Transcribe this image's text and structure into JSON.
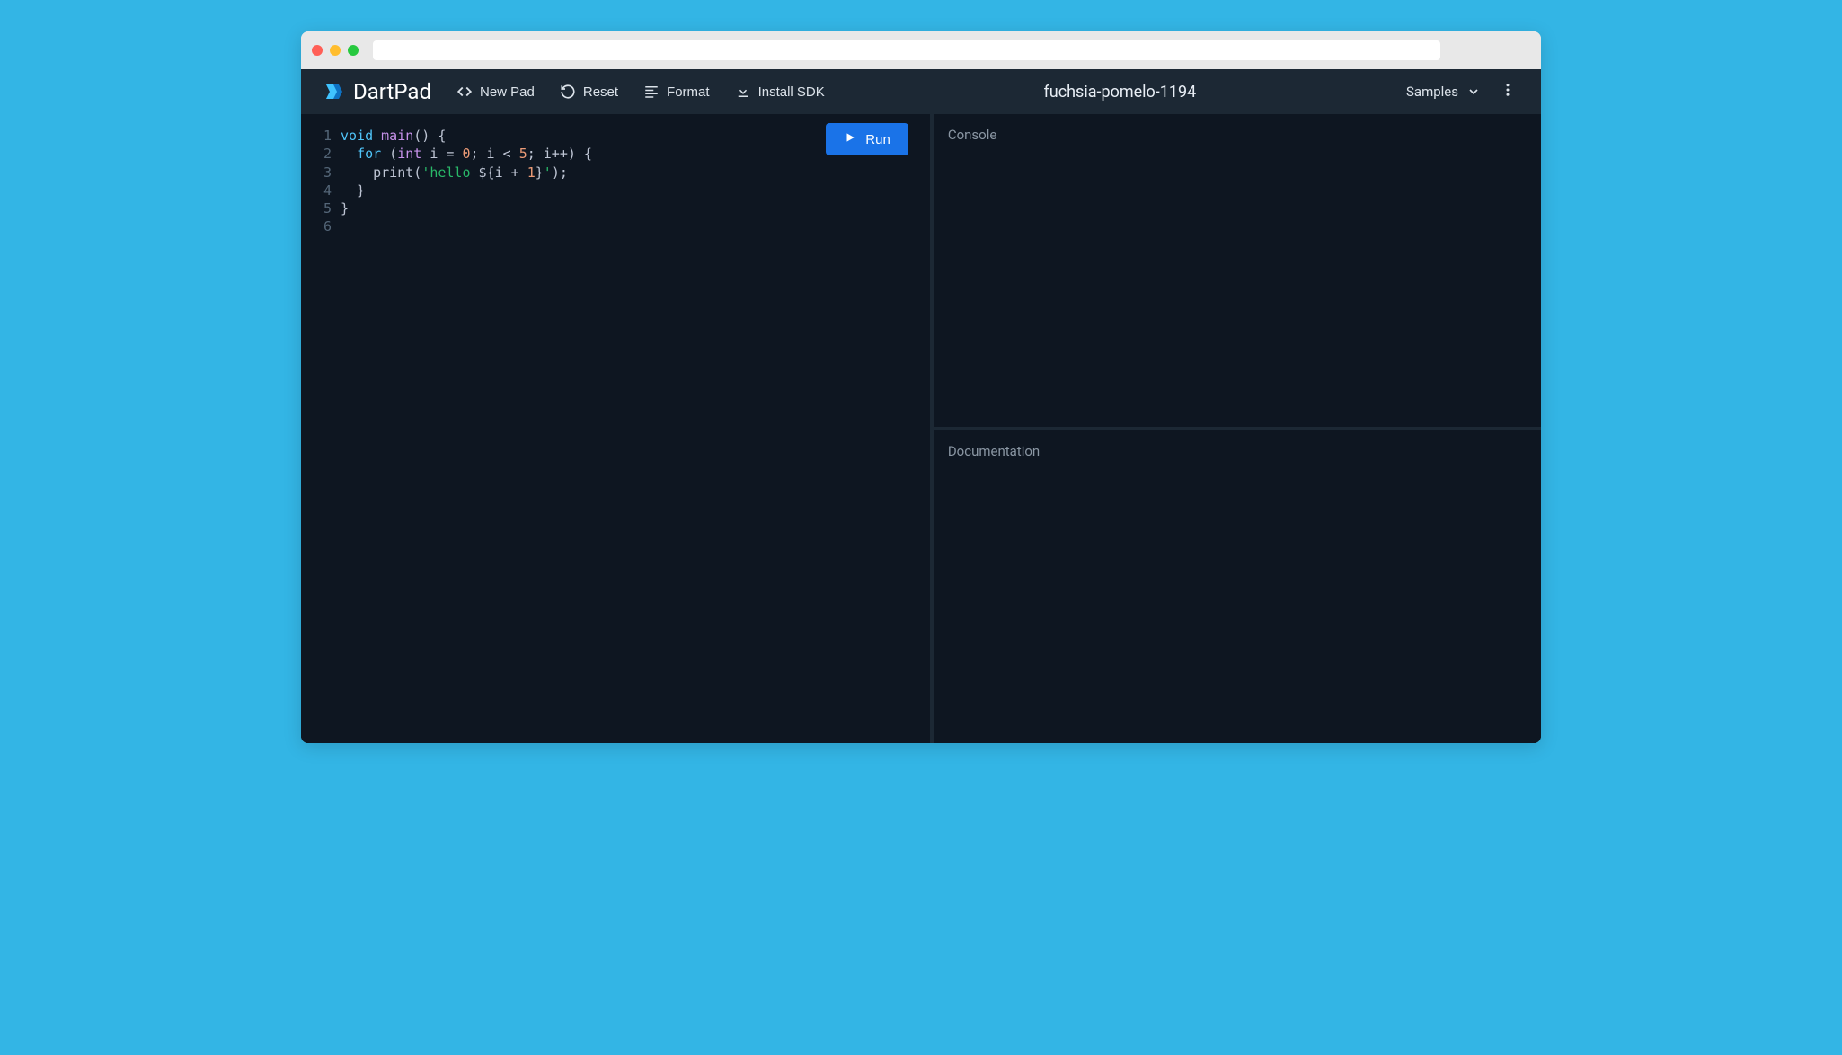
{
  "browser": {
    "url": ""
  },
  "navbar": {
    "logo_text": "DartPad",
    "buttons": {
      "new_pad": "New Pad",
      "reset": "Reset",
      "format": "Format",
      "install_sdk": "Install SDK"
    },
    "title": "fuchsia-pomelo-1194",
    "samples": "Samples"
  },
  "editor": {
    "run_label": "Run",
    "lines": [
      {
        "num": "1",
        "tokens": [
          {
            "t": "kw",
            "v": "void"
          },
          {
            "t": "plain",
            "v": " "
          },
          {
            "t": "fn",
            "v": "main"
          },
          {
            "t": "paren",
            "v": "() {"
          }
        ]
      },
      {
        "num": "2",
        "tokens": [
          {
            "t": "plain",
            "v": "  "
          },
          {
            "t": "kw",
            "v": "for"
          },
          {
            "t": "paren",
            "v": " ("
          },
          {
            "t": "type",
            "v": "int"
          },
          {
            "t": "plain",
            "v": " i = "
          },
          {
            "t": "num",
            "v": "0"
          },
          {
            "t": "plain",
            "v": "; i < "
          },
          {
            "t": "num",
            "v": "5"
          },
          {
            "t": "plain",
            "v": "; i++) {"
          }
        ]
      },
      {
        "num": "3",
        "tokens": [
          {
            "t": "plain",
            "v": "    print("
          },
          {
            "t": "str",
            "v": "'hello "
          },
          {
            "t": "interp",
            "v": "${i + "
          },
          {
            "t": "num",
            "v": "1"
          },
          {
            "t": "interp",
            "v": "}"
          },
          {
            "t": "str",
            "v": "'"
          },
          {
            "t": "plain",
            "v": ");"
          }
        ]
      },
      {
        "num": "4",
        "tokens": [
          {
            "t": "plain",
            "v": "  }"
          }
        ]
      },
      {
        "num": "5",
        "tokens": [
          {
            "t": "plain",
            "v": "}"
          }
        ]
      },
      {
        "num": "6",
        "tokens": [
          {
            "t": "plain",
            "v": ""
          }
        ]
      }
    ]
  },
  "panels": {
    "console": "Console",
    "documentation": "Documentation"
  }
}
